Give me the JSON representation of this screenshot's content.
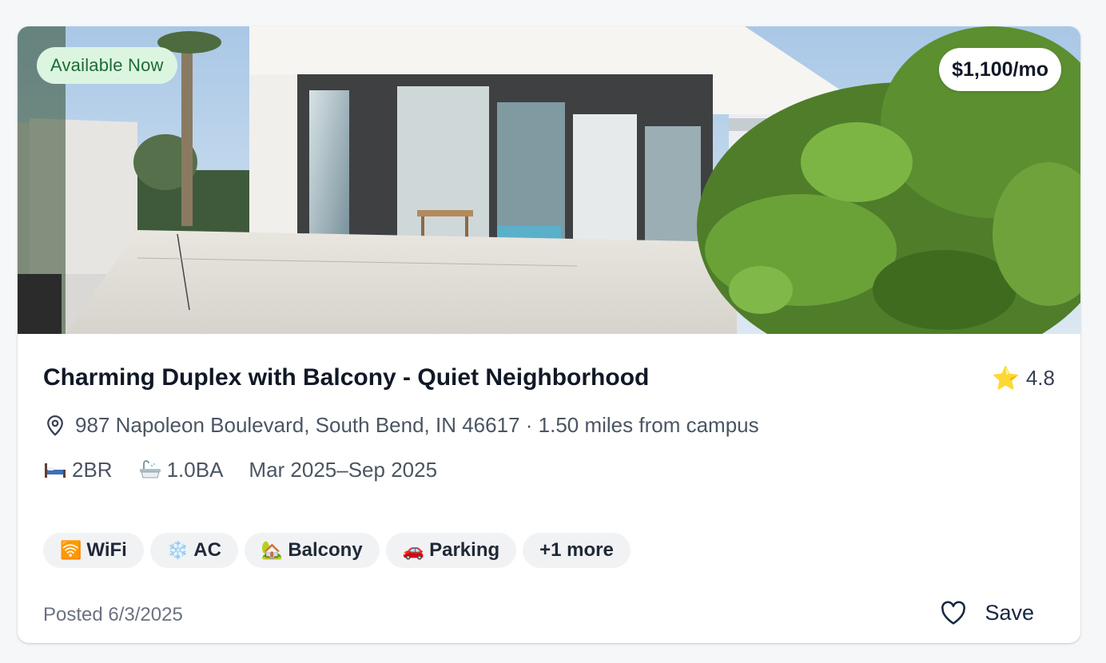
{
  "listing": {
    "availability_badge": "Available Now",
    "price": "$1,100/mo",
    "title": "Charming Duplex with Balcony - Quiet Neighborhood",
    "rating": "4.8",
    "address": "987 Napoleon Boulevard, South Bend, IN 46617 · 1.50 miles from campus",
    "bedrooms": "2BR",
    "bathrooms": "1.0BA",
    "dates": "Mar 2025–Sep 2025",
    "amenities": [
      {
        "emoji": "🛜",
        "label": "WiFi"
      },
      {
        "emoji": "❄️",
        "label": "AC"
      },
      {
        "emoji": "🏡",
        "label": "Balcony"
      },
      {
        "emoji": "🚗",
        "label": "Parking"
      }
    ],
    "more_amenities": "+1 more",
    "posted": "Posted 6/3/2025",
    "save_label": "Save"
  },
  "icons": {
    "rating": "star-icon",
    "address": "location-pin-icon",
    "bedrooms": "bed-icon",
    "bathrooms": "bathtub-icon",
    "save": "heart-icon"
  },
  "colors": {
    "available_badge_bg": "#dcf5e1",
    "available_badge_text": "#1e6b34",
    "star": "#f5b301",
    "chip_bg": "#f1f2f4"
  }
}
